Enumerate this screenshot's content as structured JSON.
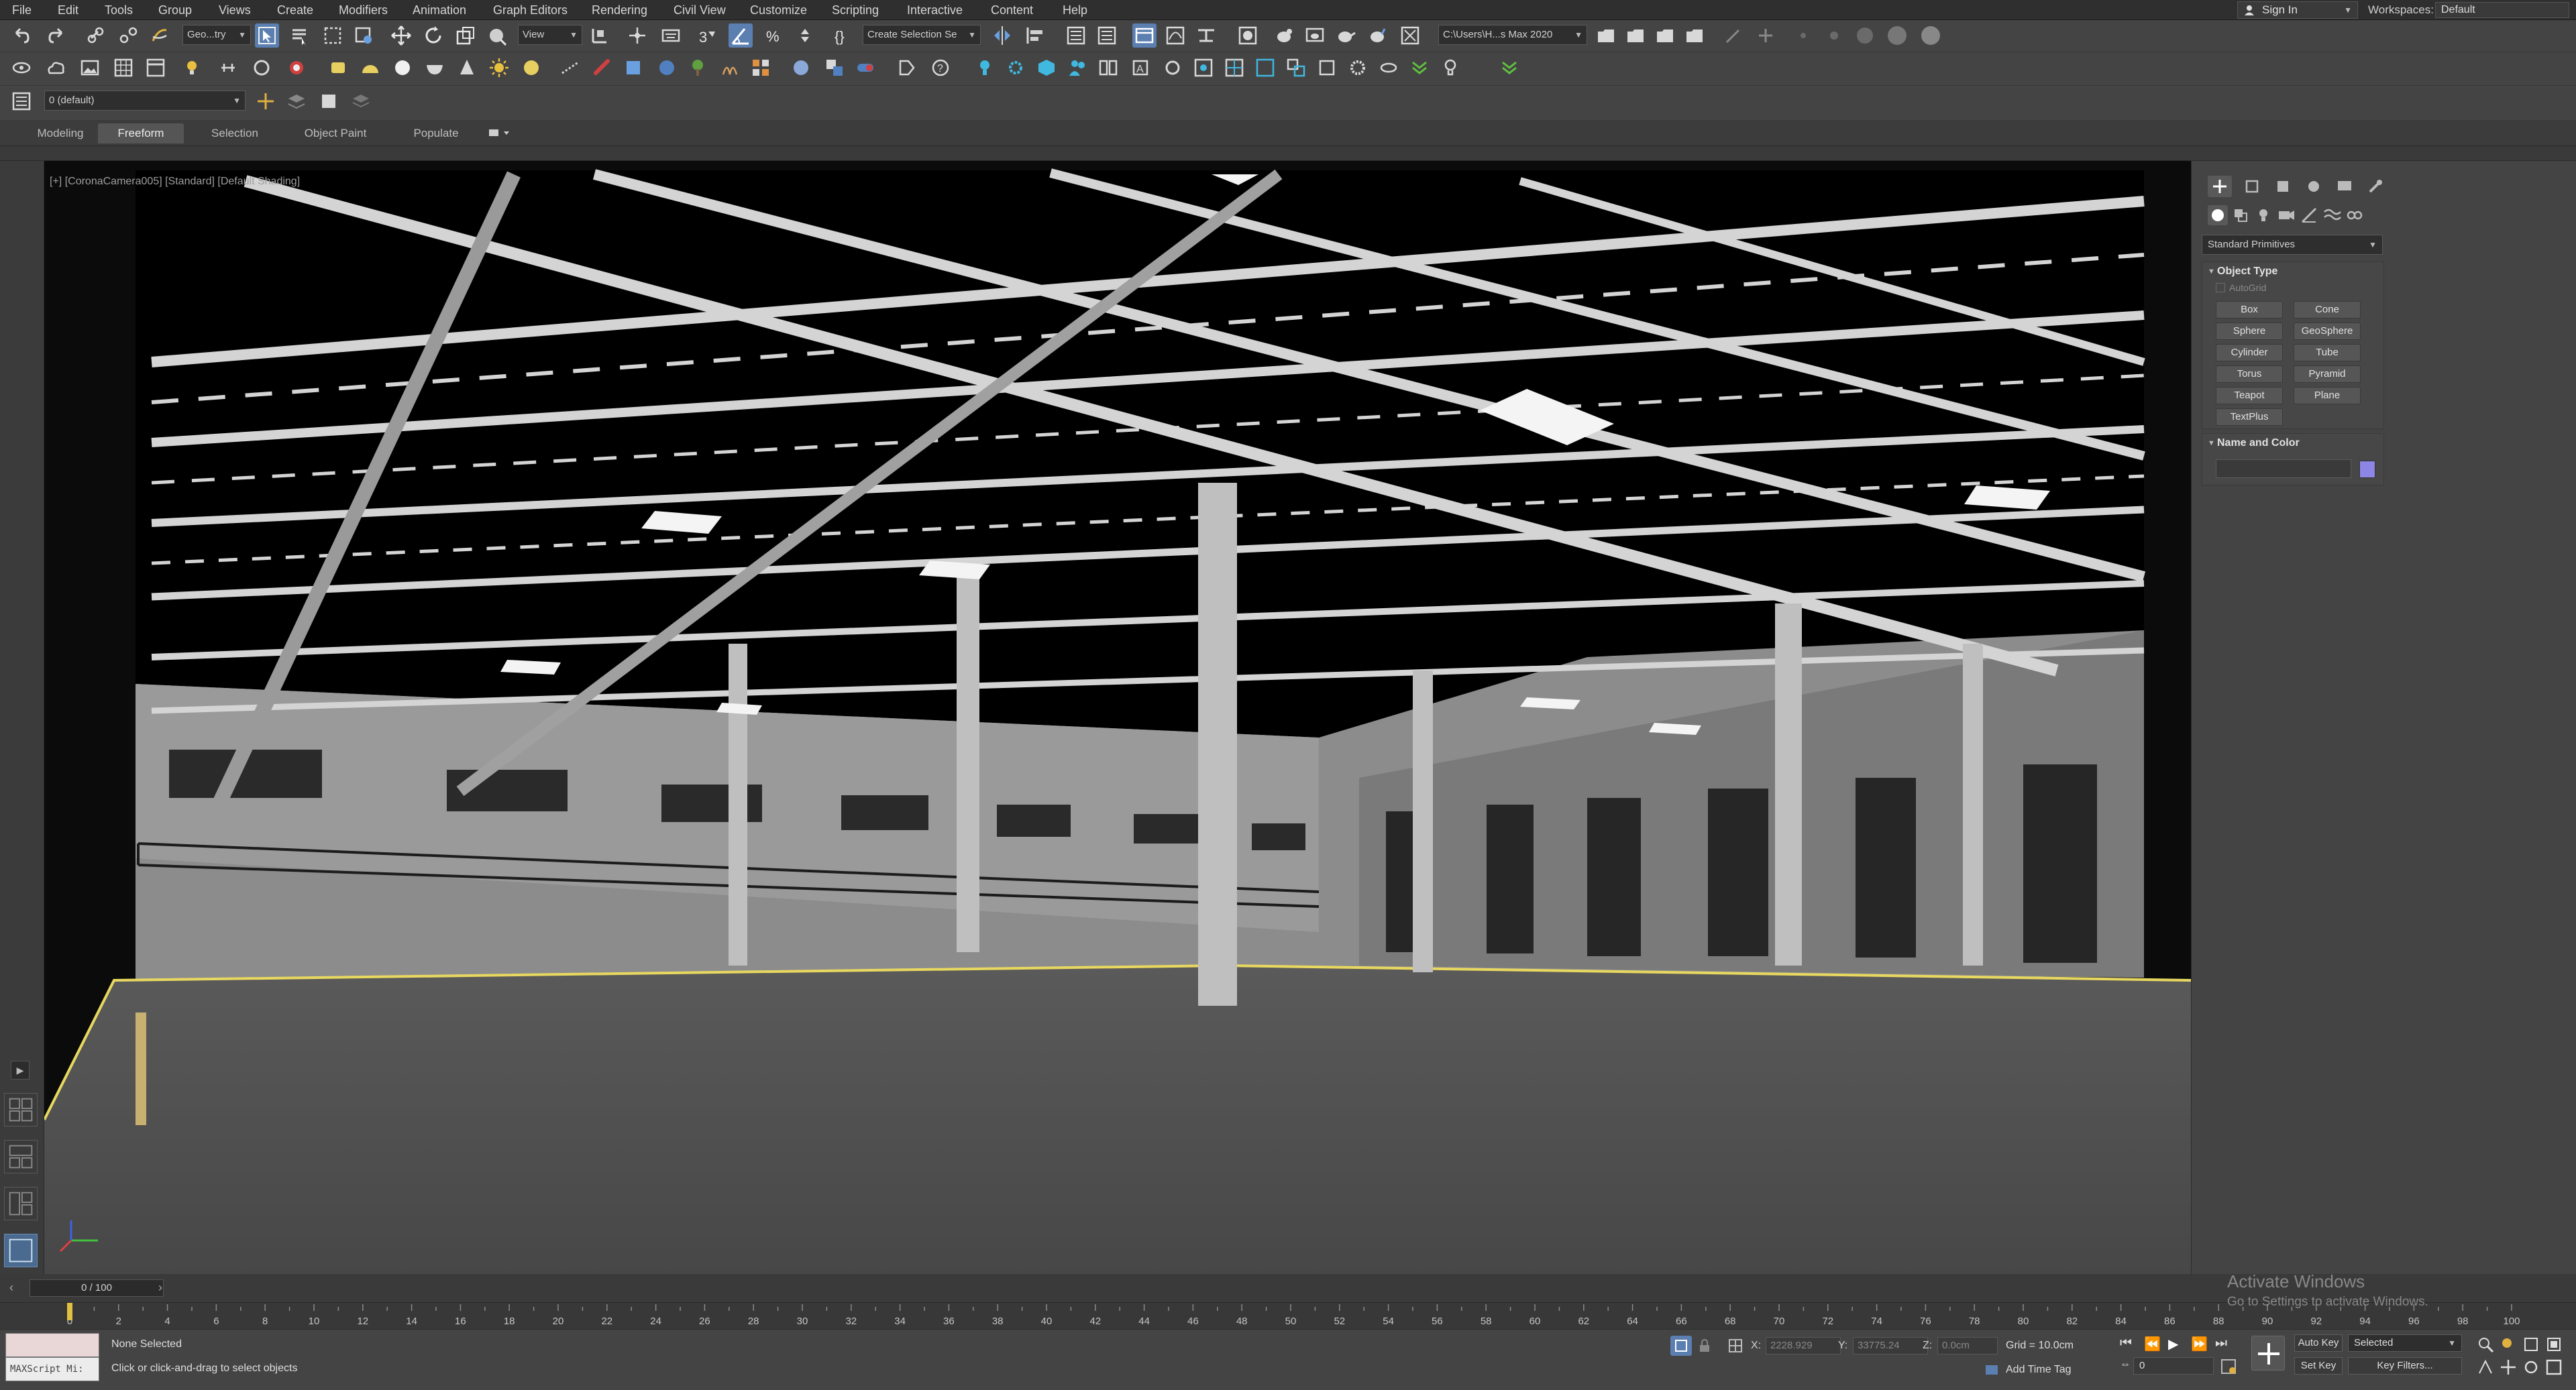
{
  "menu": [
    "File",
    "Edit",
    "Tools",
    "Group",
    "Views",
    "Create",
    "Modifiers",
    "Animation",
    "Graph Editors",
    "Rendering",
    "Civil View",
    "Customize",
    "Scripting",
    "Interactive",
    "Content",
    "Help"
  ],
  "account": {
    "signin_label": "Sign In",
    "workspaces_label": "Workspaces:",
    "workspace_value": "Default"
  },
  "toolbar1": {
    "filter_dropdown": "Geo...try",
    "refcoord_dropdown": "View",
    "selection_set_dropdown": "Create Selection Se",
    "project_path": "C:\\Users\\H...s Max 2020"
  },
  "toolbar3": {
    "layer_dropdown": "0 (default)"
  },
  "ribbon": {
    "tabs": [
      "Modeling",
      "Freeform",
      "Selection",
      "Object Paint",
      "Populate"
    ],
    "active_tab": "Freeform"
  },
  "viewport": {
    "label_plus": "[+]",
    "label_camera": "[CoronaCamera005]",
    "label_mode": "[Standard]",
    "label_shading": "[Default Shading]"
  },
  "command_panel": {
    "category_dropdown": "Standard Primitives",
    "object_type_title": "Object Type",
    "autogrid_label": "AutoGrid",
    "object_buttons": [
      "Box",
      "Cone",
      "Sphere",
      "GeoSphere",
      "Cylinder",
      "Tube",
      "Torus",
      "Pyramid",
      "Teapot",
      "Plane",
      "TextPlus"
    ],
    "name_color_title": "Name and Color",
    "object_color": "#8d86e4"
  },
  "timeline": {
    "frame_display": "0 / 100",
    "ticks": [
      0,
      2,
      4,
      6,
      8,
      10,
      12,
      14,
      16,
      18,
      20,
      22,
      24,
      26,
      28,
      30,
      32,
      34,
      36,
      38,
      40,
      42,
      44,
      46,
      48,
      50,
      52,
      54,
      56,
      58,
      60,
      62,
      64,
      66,
      68,
      70,
      72,
      74,
      76,
      78,
      80,
      82,
      84,
      86,
      88,
      90,
      92,
      94,
      96,
      98,
      100
    ]
  },
  "status": {
    "selection": "None Selected",
    "prompt": "Click or click-and-drag to select objects",
    "maxscript_label": "MAXScript Mi:",
    "x_label": "X:",
    "x_value": "2228.929",
    "y_label": "Y:",
    "y_value": "33775.24",
    "z_label": "Z:",
    "z_value": "0.0cm",
    "grid": "Grid = 10.0cm",
    "add_time_tag": "Add Time Tag",
    "auto_key": "Auto Key",
    "set_key": "Set Key",
    "selected_dropdown": "Selected",
    "key_filters": "Key Filters...",
    "current_frame": "0"
  },
  "watermark": {
    "title": "Activate Windows",
    "subtitle": "Go to Settings to activate Windows."
  }
}
